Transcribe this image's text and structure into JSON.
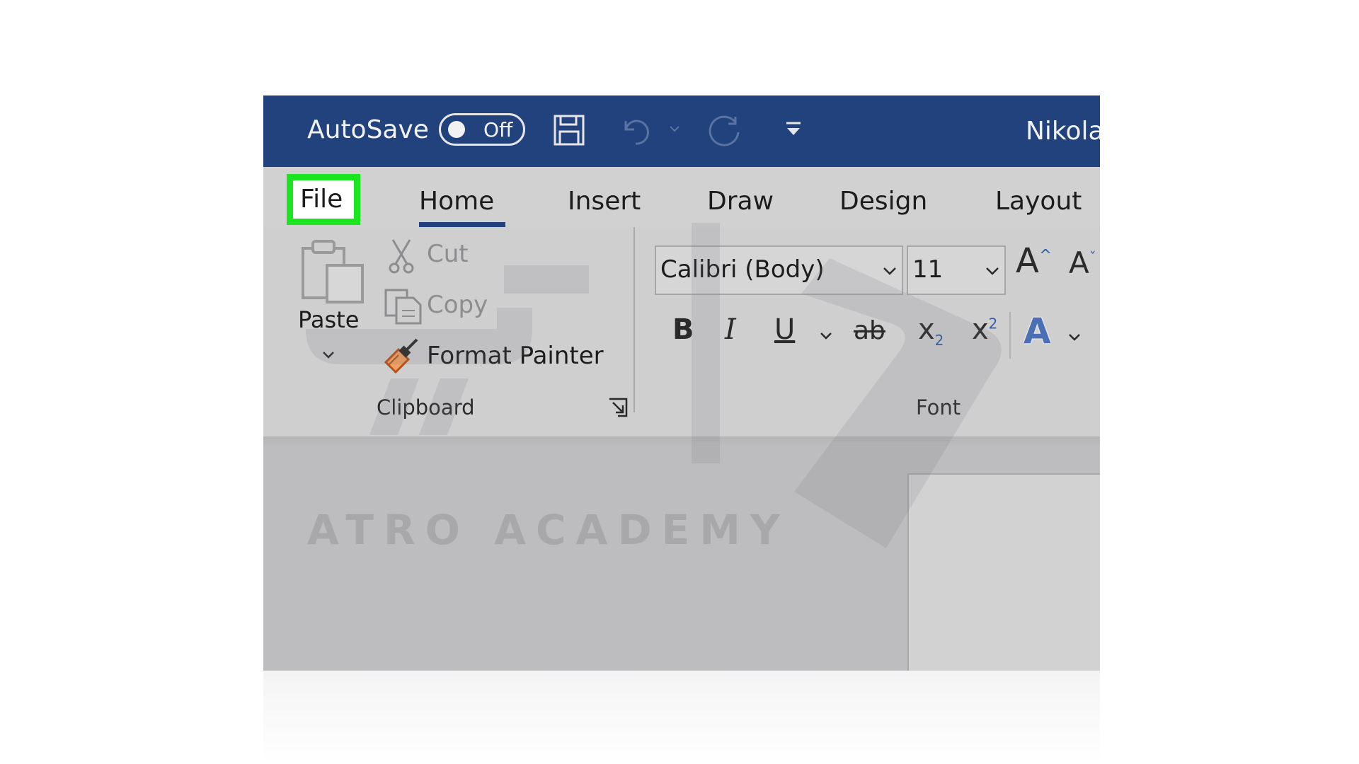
{
  "titlebar": {
    "autosave_label": "AutoSave",
    "autosave_state": "Off",
    "user_name": "Nikola"
  },
  "tabs": {
    "file": "File",
    "home": "Home",
    "insert": "Insert",
    "draw": "Draw",
    "design": "Design",
    "layout": "Layout"
  },
  "clipboard": {
    "paste_label": "Paste",
    "cut_label": "Cut",
    "copy_label": "Copy",
    "format_painter_label": "Format Painter",
    "group_label": "Clipboard"
  },
  "font": {
    "font_name": "Calibri (Body)",
    "font_size": "11",
    "group_label": "Font",
    "grow_glyph": "A",
    "shrink_glyph": "A",
    "bold_glyph": "B",
    "italic_glyph": "I",
    "underline_glyph": "U",
    "strike_glyph": "ab",
    "subscript_glyph": "x",
    "subscript_index": "2",
    "superscript_glyph": "x",
    "superscript_index": "2",
    "text_effects_glyph": "A"
  },
  "watermark": {
    "text": "ATRO ACADEMY"
  },
  "colors": {
    "titlebar": "#21427c",
    "highlight": "#19e61e",
    "ribbon": "#cfcfd0"
  }
}
